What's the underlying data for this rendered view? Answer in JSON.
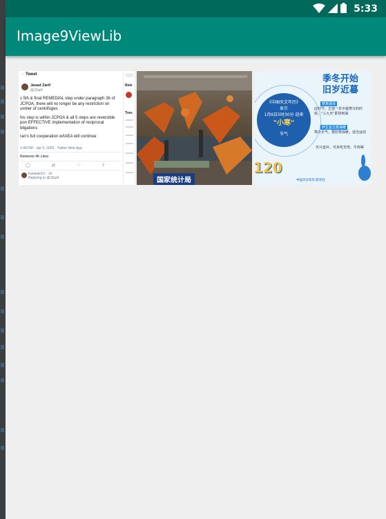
{
  "status_bar": {
    "time": "5:33"
  },
  "app_bar": {
    "title": "Image9ViewLib"
  },
  "grid": {
    "images": [
      {
        "name": "tweet-screenshot",
        "header": "Tweet",
        "author": "Javad Zarif",
        "handle": "@JZarif",
        "text": [
          "s 5th & final REMEDIAL step under paragraph 36 of",
          "JCPOA, there will no longer be any restriction on",
          "umber of centrifuges",
          "his step is within JCPOA & all 5 steps are reversible",
          "pon EFFECTIVE implementation of reciprocal",
          "bligations",
          "ran's full cooperation w/IAEA will continue"
        ],
        "meta": "1:48 PM · Jan 5, 2020 · Twitter Web App",
        "stats": "Retweets   4K Likes",
        "reply_author": "Iranwatch1 · 1h",
        "reply_to": "Replying to @JZarif",
        "side_header": "Rele",
        "side_header2": "Tren"
      },
      {
        "name": "factory-photo",
        "caption": "国家统计局"
      },
      {
        "name": "solar-term-infographic",
        "title_line1": "季冬开始",
        "title_line2": "旧岁近暮",
        "center_line1": "《中国天文年历》",
        "center_line2": "显示",
        "center_line3": "1月6日5时30分 迎来",
        "center_big": "\"小寒\"",
        "center_line4": "节气",
        "side_label1": "寒意渐浓",
        "side_text1": "此时节，正值一年中最寒冷的时候，\"三九天\"即将到来",
        "side_label2": "养生宜注意保暖",
        "side_text2": "寒冷天气，要防寒保暖，适当运动",
        "side_text3": "天冷宜补，可多吃羊肉、牛肉等",
        "number": "120",
        "footer": "中国天文年历·新华社"
      }
    ]
  }
}
